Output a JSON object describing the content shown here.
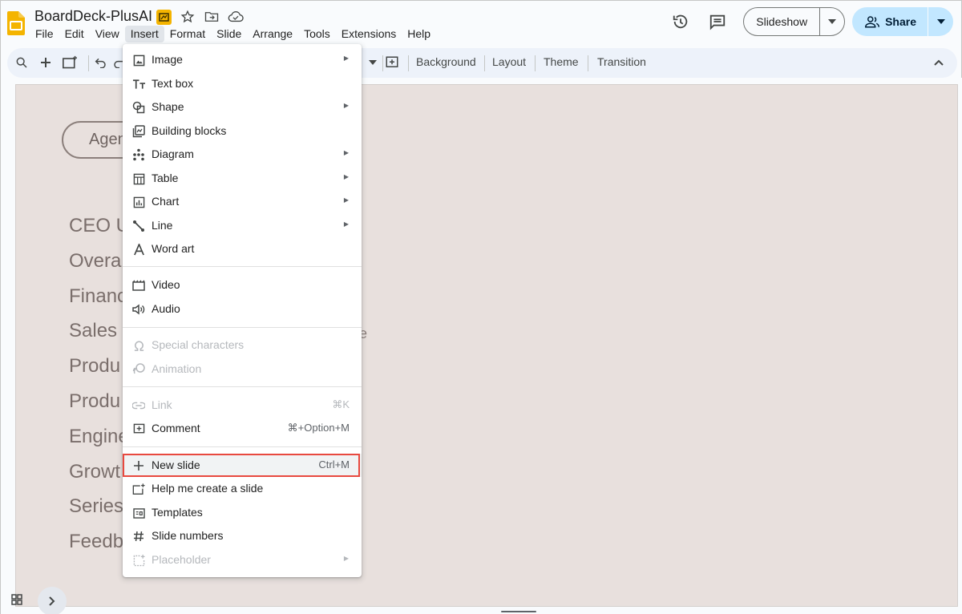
{
  "document": {
    "title": "BoardDeck-PlusAI"
  },
  "menubar": {
    "items": [
      "File",
      "Edit",
      "View",
      "Insert",
      "Format",
      "Slide",
      "Arrange",
      "Tools",
      "Extensions",
      "Help"
    ],
    "active": "Insert"
  },
  "header": {
    "slideshow_label": "Slideshow",
    "share_label": "Share"
  },
  "toolbar": {
    "background_label": "Background",
    "layout_label": "Layout",
    "theme_label": "Theme",
    "transition_label": "Transition"
  },
  "insert_menu": {
    "groups": [
      [
        {
          "label": "Image",
          "icon": "image-icon",
          "submenu": true
        },
        {
          "label": "Text box",
          "icon": "text-box-icon"
        },
        {
          "label": "Shape",
          "icon": "shape-icon",
          "submenu": true
        },
        {
          "label": "Building blocks",
          "icon": "building-blocks-icon"
        },
        {
          "label": "Diagram",
          "icon": "diagram-icon",
          "submenu": true
        },
        {
          "label": "Table",
          "icon": "table-icon",
          "submenu": true
        },
        {
          "label": "Chart",
          "icon": "chart-icon",
          "submenu": true
        },
        {
          "label": "Line",
          "icon": "line-icon",
          "submenu": true
        },
        {
          "label": "Word art",
          "icon": "word-art-icon"
        }
      ],
      [
        {
          "label": "Video",
          "icon": "video-icon"
        },
        {
          "label": "Audio",
          "icon": "audio-icon"
        }
      ],
      [
        {
          "label": "Special characters",
          "icon": "omega-icon",
          "disabled": true
        },
        {
          "label": "Animation",
          "icon": "animation-icon",
          "disabled": true
        }
      ],
      [
        {
          "label": "Link",
          "icon": "link-icon",
          "shortcut": "⌘K",
          "disabled": true
        },
        {
          "label": "Comment",
          "icon": "comment-icon",
          "shortcut": "⌘+Option+M"
        }
      ],
      [
        {
          "label": "New slide",
          "icon": "plus-icon",
          "shortcut": "Ctrl+M",
          "highlighted": true
        },
        {
          "label": "Help me create a slide",
          "icon": "sparkle-slide-icon"
        },
        {
          "label": "Templates",
          "icon": "templates-icon"
        },
        {
          "label": "Slide numbers",
          "icon": "hash-icon"
        },
        {
          "label": "Placeholder",
          "icon": "placeholder-icon",
          "submenu": true,
          "disabled": true
        }
      ]
    ]
  },
  "slide": {
    "agenda_label": "Agen",
    "stray_text": "e",
    "rows": [
      "CEO U",
      "Overa",
      "Financ",
      "Sales",
      "Produ",
      "Produ",
      "Engine",
      "Growt",
      "Series",
      "Feedb"
    ]
  },
  "colors": {
    "highlight_border": "#e8493f",
    "share_bg": "#c2e7ff",
    "toolbar_bg": "#edf2fa",
    "slide_bg": "#e8e0dd",
    "app_logo": "#f4b400"
  }
}
